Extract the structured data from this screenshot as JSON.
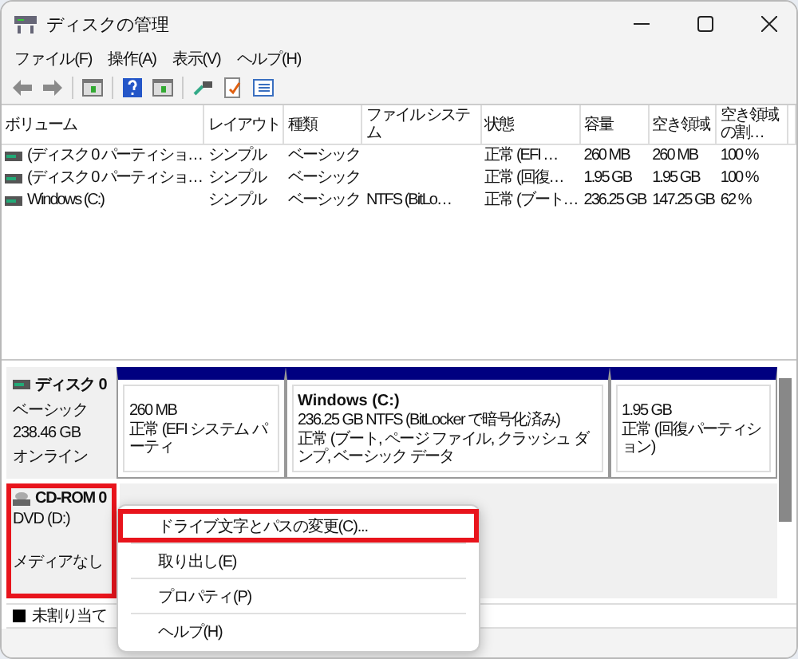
{
  "window": {
    "title": "ディスクの管理"
  },
  "menu": [
    "ファイル(F)",
    "操作(A)",
    "表示(V)",
    "ヘルプ(H)"
  ],
  "volume_table": {
    "columns": [
      "ボリューム",
      "レイアウト",
      "種類",
      "ファイル システム",
      "状態",
      "容量",
      "空き領域",
      "空き領域の割…"
    ],
    "rows": [
      {
        "cells": [
          "(ディスク 0 パーティショ…",
          "シンプル",
          "ベーシック",
          "",
          "正常 (EFI …",
          "260 MB",
          "260 MB",
          "100 %"
        ]
      },
      {
        "cells": [
          "(ディスク 0 パーティショ…",
          "シンプル",
          "ベーシック",
          "",
          "正常 (回復…",
          "1.95 GB",
          "1.95 GB",
          "100 %"
        ]
      },
      {
        "cells": [
          "Windows (C:)",
          "シンプル",
          "ベーシック",
          "NTFS (BitLo…",
          "正常 (ブート…",
          "236.25 GB",
          "147.25 GB",
          "62 %"
        ]
      }
    ]
  },
  "disks": [
    {
      "kind": "disk",
      "name": "ディスク 0",
      "highlighted": false,
      "details": [
        "ベーシック",
        "238.46 GB",
        "オンライン"
      ],
      "partitions": [
        {
          "lines": [
            "260 MB",
            "正常 (EFI システム パーティ"
          ]
        },
        {
          "title": "Windows  (C:)",
          "lines": [
            "236.25 GB NTFS (BitLocker で暗号化済み)",
            "正常 (ブート, ページ ファイル, クラッシュ ダンプ, ベーシック データ"
          ]
        },
        {
          "lines": [
            "1.95 GB",
            "正常 (回復パーティション)"
          ]
        }
      ]
    },
    {
      "kind": "cdrom",
      "name": "CD-ROM 0",
      "highlighted": true,
      "details": [
        "DVD (D:)",
        "メディアなし"
      ]
    }
  ],
  "legend": [
    {
      "label": "未割り当て"
    }
  ],
  "context_menu": {
    "items": [
      {
        "label": "ドライブ文字とパスの変更(C)...",
        "highlighted": true
      },
      {
        "label": "取り出し(E)",
        "highlighted": false
      },
      {
        "label": "プロパティ(P)",
        "highlighted": false
      },
      {
        "label": "ヘルプ(H)",
        "highlighted": false
      }
    ]
  }
}
